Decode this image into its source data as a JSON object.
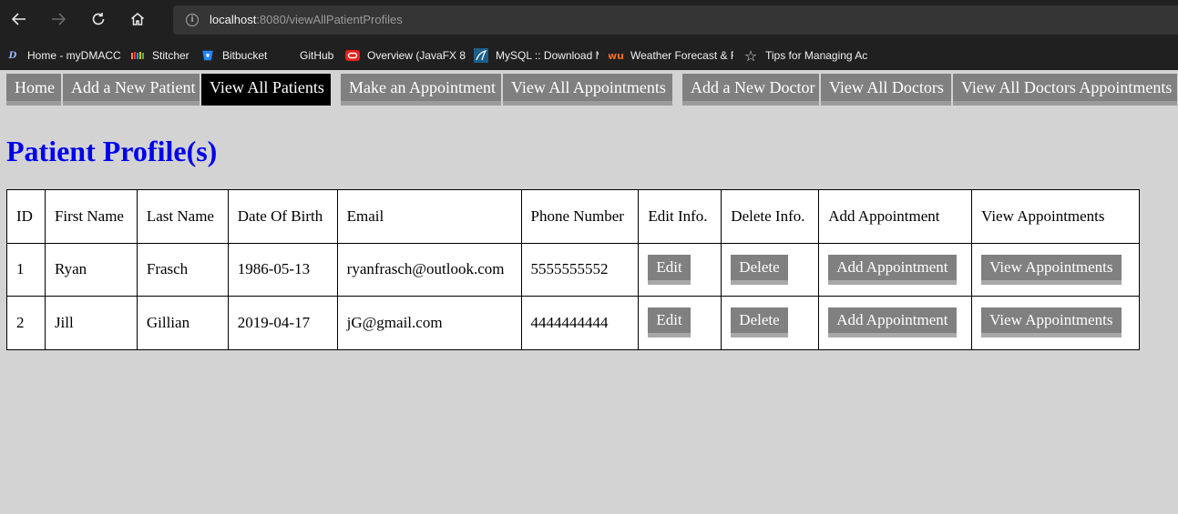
{
  "browser": {
    "url_host": "localhost",
    "url_path": ":8080/viewAllPatientProfiles",
    "bookmarks": [
      {
        "label": "Home - myDMACC",
        "icon": "dmacc-icon"
      },
      {
        "label": "Stitcher",
        "icon": "stitcher-icon"
      },
      {
        "label": "Bitbucket",
        "icon": "bitbucket-icon"
      },
      {
        "label": "GitHub",
        "icon": "github-icon"
      },
      {
        "label": "Overview (JavaFX 8)",
        "icon": "oracle-icon"
      },
      {
        "label": "MySQL :: Download M",
        "icon": "mysql-icon"
      },
      {
        "label": "Weather Forecast & F",
        "icon": "wunderground-icon"
      },
      {
        "label": "Tips for Managing Ac",
        "icon": "star-icon"
      }
    ]
  },
  "nav": {
    "items": [
      {
        "label": "Home"
      },
      {
        "label": "Add a New Patient"
      },
      {
        "label": "View All Patients"
      },
      {
        "label": "Make an Appointment"
      },
      {
        "label": "View All Appointments"
      },
      {
        "label": "Add a New Doctor"
      },
      {
        "label": "View All Doctors"
      },
      {
        "label": "View All Doctors Appointments"
      }
    ]
  },
  "page": {
    "title": "Patient Profile(s)"
  },
  "table": {
    "headers": [
      "ID",
      "First Name",
      "Last Name",
      "Date Of Birth",
      "Email",
      "Phone Number",
      "Edit Info.",
      "Delete Info.",
      "Add Appointment",
      "View Appointments"
    ],
    "rows": [
      {
        "id": "1",
        "first": "Ryan",
        "last": "Frasch",
        "dob": "1986-05-13",
        "email": "ryanfrasch@outlook.com",
        "phone": "5555555552"
      },
      {
        "id": "2",
        "first": "Jill",
        "last": "Gillian",
        "dob": "2019-04-17",
        "email": "jG@gmail.com",
        "phone": "4444444444"
      }
    ],
    "edit_label": "Edit",
    "delete_label": "Delete",
    "add_appt_label": "Add Appointment",
    "view_appt_label": "View Appointments"
  }
}
